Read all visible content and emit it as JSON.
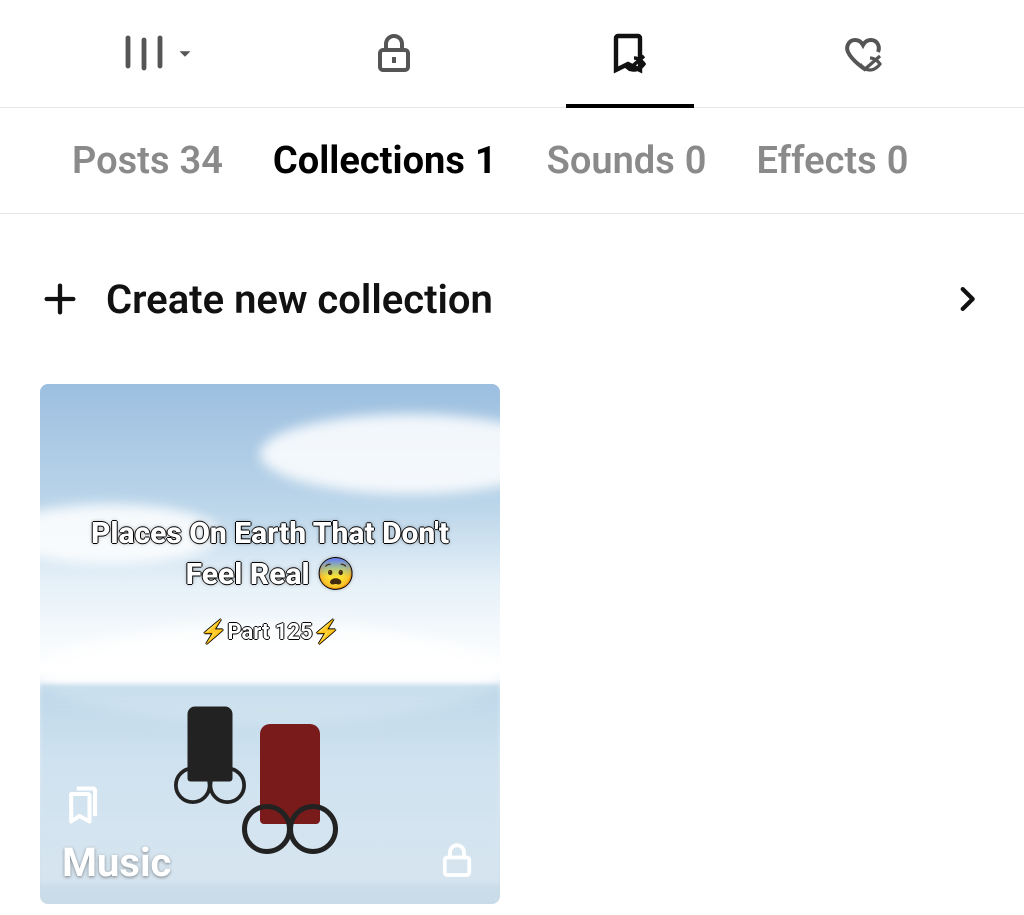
{
  "top_tabs": {
    "grid": {
      "name": "grid"
    },
    "private": {
      "name": "lock"
    },
    "saved": {
      "name": "bookmark",
      "active": true
    },
    "liked": {
      "name": "heart-hidden"
    }
  },
  "sub_tabs": [
    {
      "label": "Posts",
      "count": "34",
      "active": false
    },
    {
      "label": "Collections",
      "count": "1",
      "active": true
    },
    {
      "label": "Sounds",
      "count": "0",
      "active": false
    },
    {
      "label": "Effects",
      "count": "0",
      "active": false
    }
  ],
  "create_row": {
    "label": "Create new collection"
  },
  "collections": [
    {
      "name": "Music",
      "private": true,
      "thumb_title": "Places On Earth That Don't Feel Real 😨",
      "thumb_subtitle": "⚡Part 125⚡"
    }
  ]
}
